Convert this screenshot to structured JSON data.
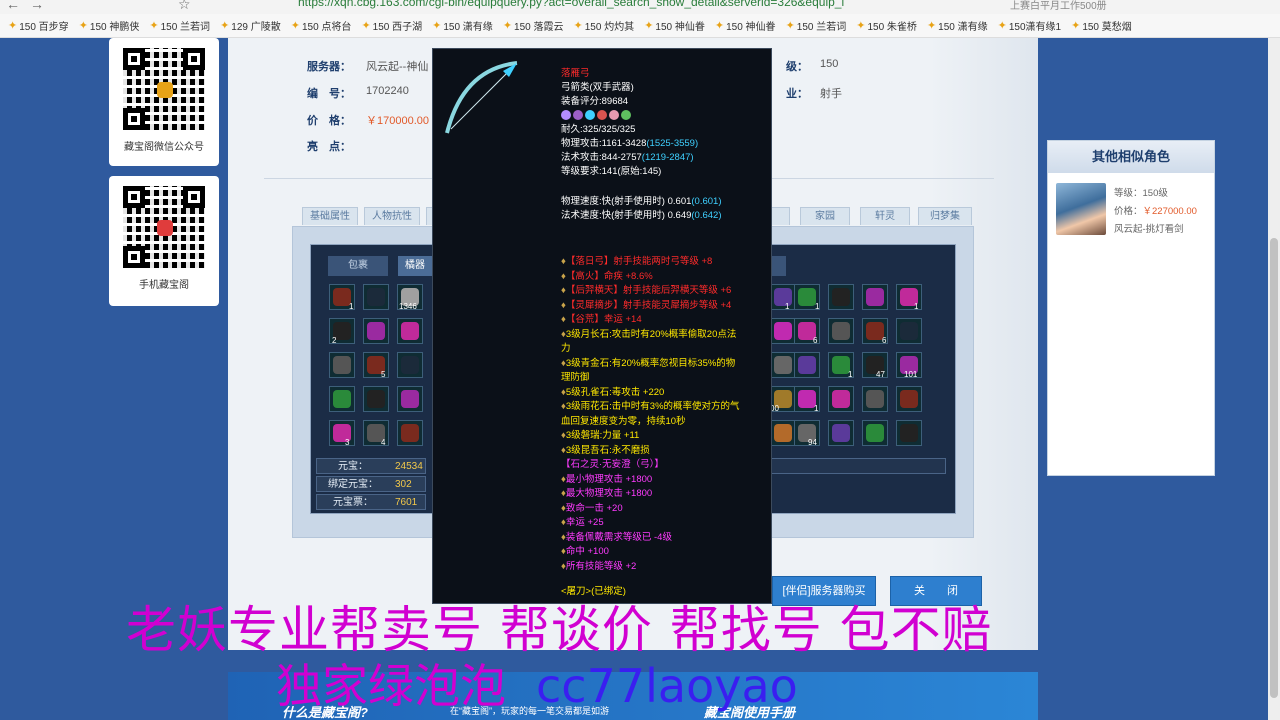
{
  "browser": {
    "url": "https://xqn.cbg.163.com/cgi-bin/equipquery.py?act=overall_search_show_detail&serverid=326&equip_i",
    "search_hint": "上赛白平月工作500册",
    "bookmarks": [
      "150 百步穿",
      "150 神鹏侠",
      "150 兰若词",
      "129 广陵散",
      "150 点将台",
      "150 西子湖",
      "150 潇有缘",
      "150 落霞云",
      "150 灼灼其",
      "150 神仙眷",
      "150 神仙眷",
      "150 兰若词",
      "150 朱雀桥",
      "150 潇有缘",
      "150潇有缘1",
      "150 莫愁烟"
    ]
  },
  "left_panel": {
    "qr1_caption": "藏宝阁微信公众号",
    "qr2_caption": "手机藏宝阁"
  },
  "detail": {
    "server_label": "服务器：",
    "server_value": "风云起--神仙",
    "id_label": "编　号：",
    "id_value": "1702240",
    "price_label": "价　格：",
    "price_value": "￥170000.00",
    "highlight_label": "亮　点：",
    "level_label": "级：",
    "level_value": "150",
    "job_label": "业：",
    "job_value": "射手"
  },
  "tabs": [
    "基础属性",
    "人物抗性",
    "",
    "",
    "",
    "",
    "",
    "",
    "",
    "",
    "家园",
    "轩灵",
    "归梦集"
  ],
  "subtabs": {
    "left": "包裹",
    "active": "橘器"
  },
  "inventory_counts": {
    "a": "1",
    "b": "1346",
    "c": "2",
    "d": "5",
    "e": "1",
    "f": "3",
    "g": "4",
    "h": "1",
    "i": "6",
    "j": "6",
    "k": "1",
    "l": "47",
    "m": "101",
    "n": "00",
    "o": "1",
    "p": "1",
    "q": "94",
    "r": "1",
    "s": "1",
    "t": "1",
    "u": "1",
    "v": "1"
  },
  "wallet": [
    {
      "label": "元宝：",
      "value": "24534"
    },
    {
      "label": "绑定元宝：",
      "value": "302"
    },
    {
      "label": "元宝票：",
      "value": "7601"
    }
  ],
  "tooltip": {
    "name": "落雁弓",
    "type": "弓箭类(双手武器)",
    "score": "装备评分:89684",
    "durability": "耐久:325/325/325",
    "phys_attack": "物理攻击:1161-3428",
    "phys_attack_bonus": "(1525-3559)",
    "magic_attack": "法术攻击:844-2757",
    "magic_attack_bonus": "(1219-2847)",
    "level_req": "等级要求:141(原始:145)",
    "phys_speed": "物理速度:快(射手使用时) 0.601",
    "phys_speed_bonus": "(0.601)",
    "magic_speed": "法术速度:快(射手使用时) 0.649",
    "magic_speed_bonus": "(0.642)",
    "red_lines": [
      "【落日弓】射手技能两时弓等级 +8",
      "【高火】命疾 +8.6%",
      "【后羿横天】射手技能后羿横天等级 +6",
      "【灵犀摘步】射手技能灵犀摘步等级 +4",
      "【谷荒】幸运 +14"
    ],
    "gem_lines": [
      "3级月长石:攻击时有20%概率偷取20点法",
      "力",
      "3级青金石:有20%概率忽视目标35%的物",
      "理防御",
      "5级孔雀石:毒攻击 +220",
      "3级雨花石:击中时有3%的概率使对方的气",
      "血回复速度变为零，持续10秒",
      "3级磐瑞:力量 +11",
      "3级昆吾石:永不磨损"
    ],
    "soul_title": "【石之灵·无妄澄（弓）】",
    "soul_lines": [
      "最小物理攻击 +1800",
      "最大物理攻击 +1800",
      "致命一击 +20",
      "幸运 +25",
      "装备佩戴需求等级已 -4级",
      "命中 +100",
      "所有技能等级 +2"
    ],
    "footer": "<屠刀>(已绑定)"
  },
  "right_card": {
    "title": "其他相似角色",
    "level": "等级：150级",
    "price_label": "价格：",
    "price": "￥227000.00",
    "server": "风云起-挑灯看剑"
  },
  "buttons": {
    "buy": "[伴侣]服务器购买",
    "close": "关　　闭"
  },
  "overlay": {
    "line1": "老妖专业帮卖号 帮谈价 帮找号 包不赔",
    "line2": "独家绿泡泡",
    "handle": "cc77laoyao"
  },
  "footer": {
    "what": "什么是藏宝阁?",
    "sub": "在“藏宝阁”，玩家的每一笔交易都是如游",
    "guide": "藏宝阁使用手册"
  }
}
